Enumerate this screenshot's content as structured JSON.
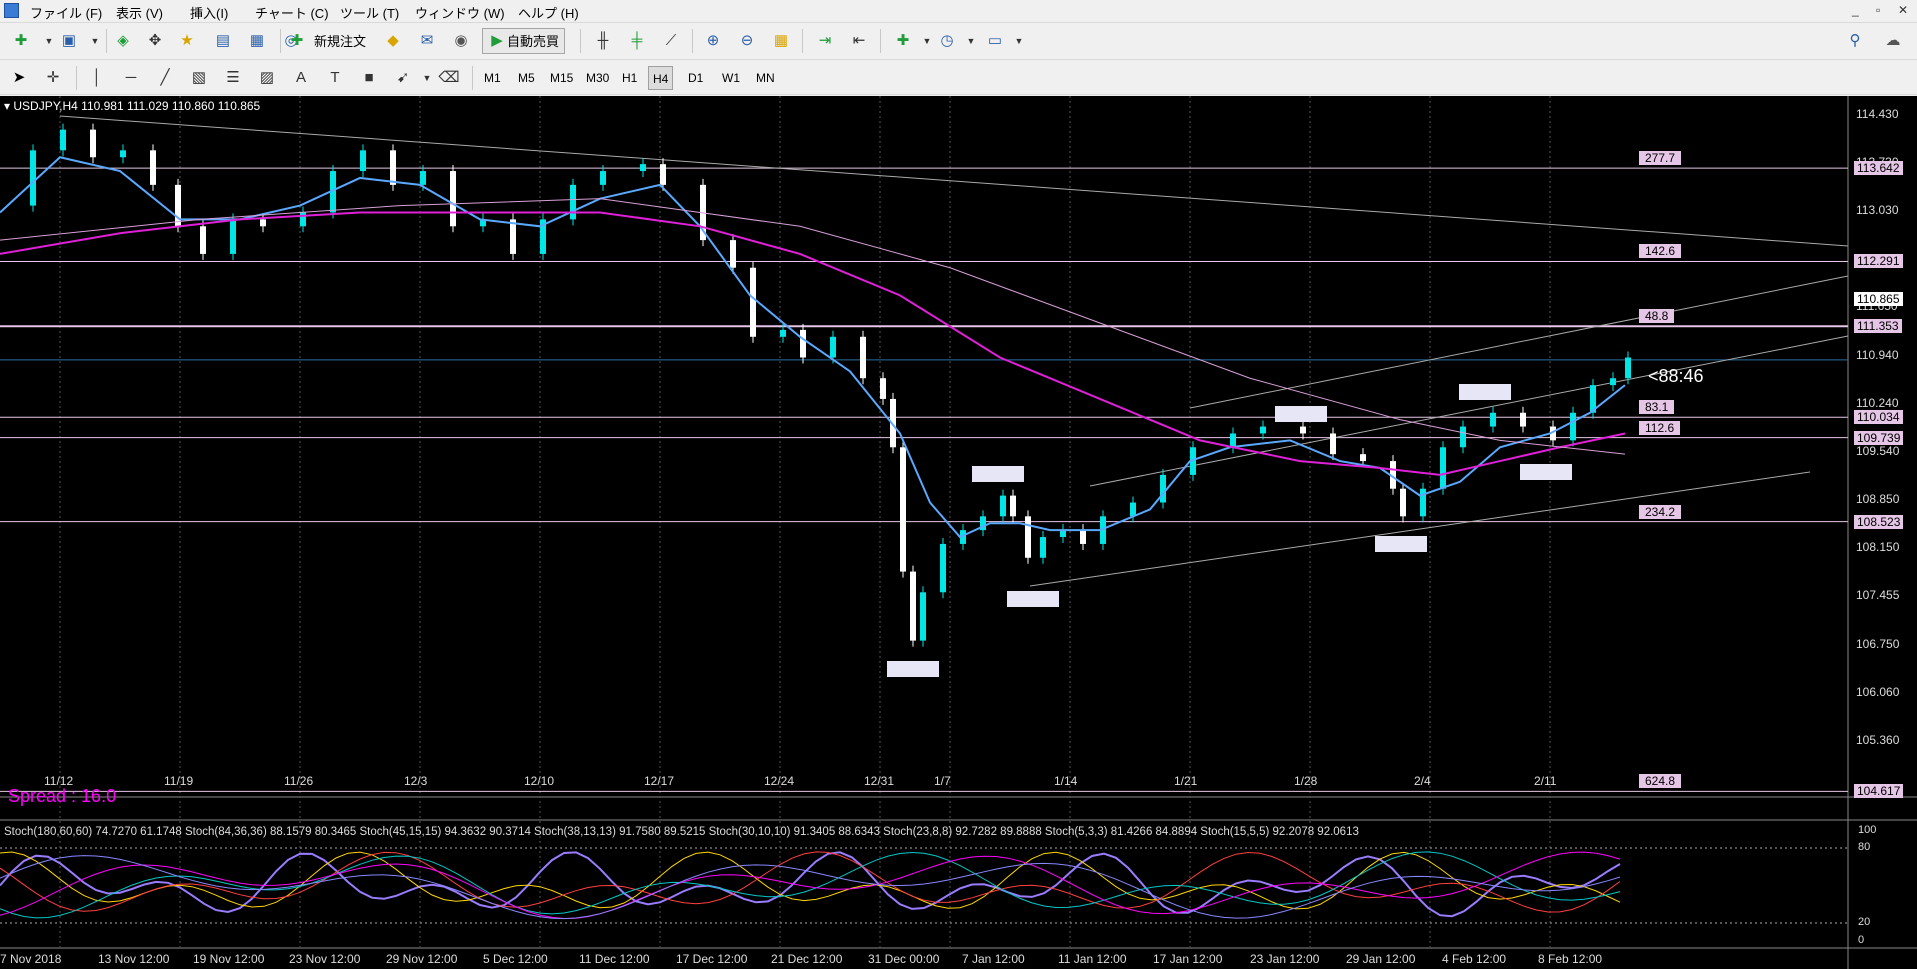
{
  "menubar": {
    "items": [
      "ファイル (F)",
      "表示 (V)",
      "挿入(I)",
      "チャート (C)",
      "ツール (T)",
      "ウィンドウ (W)",
      "ヘルプ (H)"
    ],
    "window_controls": [
      "_",
      "▫",
      "✕"
    ]
  },
  "toolbar": {
    "new_order_label": "新規注文",
    "auto_trade_label": "自動売買",
    "icons": [
      "new-chart-icon",
      "profiles-icon",
      "market-watch-icon",
      "navigator-icon",
      "favorites-icon",
      "data-window-icon",
      "terminal-icon",
      "strategy-tester-icon",
      "new-order-icon",
      "gold-icon",
      "mailbox-icon",
      "signal-icon",
      "auto-trading-icon",
      "bar-chart-icon",
      "candlestick-icon",
      "line-chart-icon",
      "zoom-in-icon",
      "zoom-out-icon",
      "tile-windows-icon",
      "chart-shift-icon",
      "auto-scroll-icon",
      "indicators-icon",
      "periods-icon",
      "templates-icon",
      "search-icon",
      "chat-icon"
    ]
  },
  "drawing_toolbar": {
    "timeframes": [
      "M1",
      "M5",
      "M15",
      "M30",
      "H1",
      "H4",
      "D1",
      "W1",
      "MN"
    ],
    "active_timeframe": "H4",
    "text_tool": "A"
  },
  "chart": {
    "symbol_info": "USDJPY,H4  110.981 111.029 110.860 110.865",
    "spread_text": "Spread : 16.0",
    "countdown": "<88:46",
    "colors": {
      "background": "#000000",
      "bull": "#00e5e5",
      "bear": "#ffffff",
      "ma_fast": "#5aa9ff",
      "ma_slow": "#e020d8",
      "ma_long": "#d8a0d8",
      "spread": "#ff00ff"
    },
    "price_axis": [
      "114.430",
      "113.730",
      "113.030",
      "112.330",
      "111.650",
      "110.940",
      "110.240",
      "109.540",
      "108.850",
      "108.150",
      "107.455",
      "106.750",
      "106.060",
      "105.360"
    ],
    "date_labels": [
      "11/12",
      "11/19",
      "11/26",
      "12/3",
      "12/10",
      "12/17",
      "12/24",
      "12/31",
      "1/7",
      "1/14",
      "1/21",
      "1/28",
      "2/4",
      "2/11"
    ],
    "levels": [
      {
        "price": "113.642",
        "distance": "277.7"
      },
      {
        "price": "112.291",
        "distance": "142.6"
      },
      {
        "price": "111.353",
        "distance": "48.8"
      },
      {
        "price": "110.034",
        "distance": "83.1"
      },
      {
        "price": "109.739",
        "distance": "112.6"
      },
      {
        "price": "108.523",
        "distance": "234.2"
      },
      {
        "price": "104.617",
        "distance": "624.8"
      }
    ],
    "current_price": "110.865"
  },
  "subwindow": {
    "stoch_label": "Stoch(180,60,60) 74.7270 61.1748  Stoch(84,36,36) 88.1579 80.3465  Stoch(45,15,15) 94.3632 90.3714  Stoch(38,13,13) 91.7580 89.5215  Stoch(30,10,10) 91.3405 88.6343  Stoch(23,8,8) 92.7282 89.8888  Stoch(5,3,3) 81.4266 84.8894  Stoch(15,5,5) 92.2078 92.0613",
    "axis": [
      "100",
      "80",
      "20",
      "0"
    ]
  },
  "time_axis": [
    "7 Nov 2018",
    "13 Nov 12:00",
    "19 Nov 12:00",
    "23 Nov 12:00",
    "29 Nov 12:00",
    "5 Dec 12:00",
    "11 Dec 12:00",
    "17 Dec 12:00",
    "21 Dec 12:00",
    "31 Dec 00:00",
    "7 Jan 12:00",
    "11 Jan 12:00",
    "17 Jan 12:00",
    "23 Jan 12:00",
    "29 Jan 12:00",
    "4 Feb 12:00",
    "8 Feb 12:00"
  ]
}
